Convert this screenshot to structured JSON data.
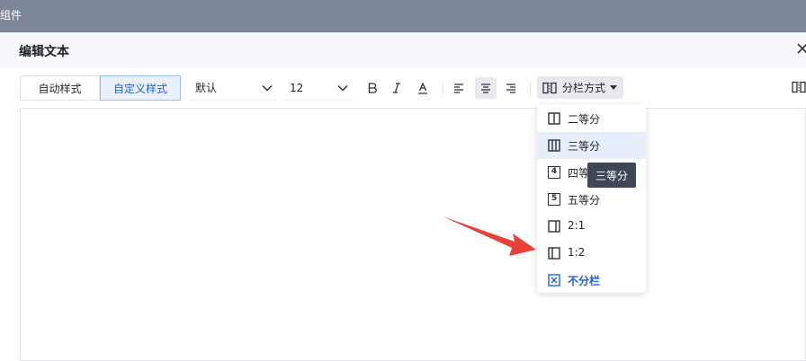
{
  "topbar": {
    "title": "组件"
  },
  "dialog": {
    "title": "编辑文本"
  },
  "toolbar": {
    "style_tabs": [
      {
        "label": "自动样式"
      },
      {
        "label": "自定义样式"
      }
    ],
    "font_family": {
      "value": "默认"
    },
    "font_size": {
      "value": "12"
    },
    "columns_button": {
      "label": "分栏方式"
    }
  },
  "columns_menu": {
    "items": [
      {
        "label": "二等分",
        "icon": "two-columns-icon"
      },
      {
        "label": "三等分",
        "icon": "three-columns-icon",
        "active": true
      },
      {
        "label": "四等分",
        "icon": "number-4-icon",
        "badge": "4"
      },
      {
        "label": "五等分",
        "icon": "number-5-icon",
        "badge": "5"
      },
      {
        "label": "2:1",
        "icon": "ratio-2-1-icon"
      },
      {
        "label": "1:2",
        "icon": "ratio-1-2-icon"
      },
      {
        "label": "不分栏",
        "icon": "no-columns-icon"
      }
    ]
  },
  "tooltip": {
    "text": "三等分"
  },
  "colors": {
    "accent": "#1e63d6",
    "annotation_arrow": "#e8403a",
    "tooltip_bg": "#3e4757"
  }
}
